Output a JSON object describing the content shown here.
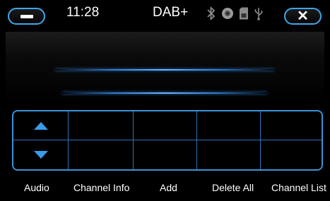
{
  "status_bar": {
    "time": "11:28",
    "mode": "DAB+",
    "icons": [
      "bluetooth-icon",
      "disc-icon",
      "sd-card-icon",
      "usb-icon"
    ],
    "minimize_icon": "minus-icon",
    "close_icon": "close-icon",
    "close_glyph": "✕"
  },
  "station_display": {
    "lines": [
      "",
      ""
    ]
  },
  "preset_grid": {
    "up_icon": "arrow-up-icon",
    "down_icon": "arrow-down-icon",
    "row1": [
      "",
      "",
      "",
      ""
    ],
    "row2": [
      "",
      "",
      "",
      ""
    ]
  },
  "softkeys": {
    "audio": "Audio",
    "channel_info": "Channel Info",
    "add": "Add",
    "delete_all": "Delete All",
    "channel_list": "Channel List"
  },
  "colors": {
    "accent": "#3fa7ea",
    "background": "#000000"
  }
}
